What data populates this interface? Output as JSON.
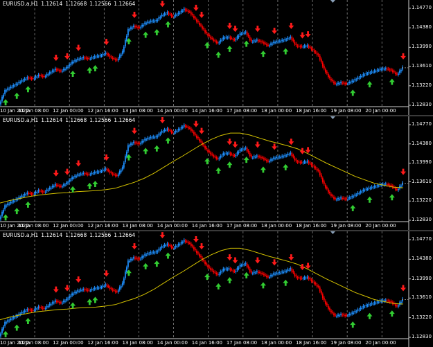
{
  "panels": [
    {
      "symbol": "EURUSD.a,H1",
      "quote": [
        "1.12614",
        "1.12668",
        "1.12566",
        "1.12664"
      ],
      "show_ma": false
    },
    {
      "symbol": "EURUSD.a,H1",
      "quote": [
        "1.12614",
        "1.12668",
        "1.12566",
        "1.12664"
      ],
      "show_ma": true
    },
    {
      "symbol": "EURUSD.a,H1",
      "quote": [
        "1.12614",
        "1.12668",
        "1.12566",
        "1.12664"
      ],
      "show_ma": true
    }
  ],
  "price_axis": [
    "1.14770",
    "1.14380",
    "1.13990",
    "1.13610",
    "1.13220",
    "1.12830"
  ],
  "time_axis": [
    "10 Jan 2022",
    "11 Jan 08:00",
    "12 Jan 00:00",
    "12 Jan 16:00",
    "13 Jan 08:00",
    "14 Jan 00:00",
    "14 Jan 16:00",
    "17 Jan 08:00",
    "18 Jan 00:00",
    "18 Jan 16:00",
    "19 Jan 08:00",
    "20 Jan 00:00"
  ],
  "colors": {
    "background": "#000000",
    "bull": "#1E90FF",
    "bear": "#FF0000",
    "arrow_up": "#32CD32",
    "arrow_down": "#FF1A1A",
    "ma": "#D4C200",
    "grid": "#8a8a8a"
  },
  "chart_data": {
    "type": "line",
    "x_label_ticks": [
      "10 Jan 2022",
      "11 Jan 08:00",
      "12 Jan 00:00",
      "12 Jan 16:00",
      "13 Jan 08:00",
      "14 Jan 00:00",
      "14 Jan 16:00",
      "17 Jan 08:00",
      "18 Jan 00:00",
      "18 Jan 16:00",
      "19 Jan 08:00",
      "20 Jan 00:00"
    ],
    "ylim": [
      1.1283,
      1.1477
    ],
    "series": [
      {
        "values": [
          1.1285,
          1.1312,
          1.1319,
          1.1325,
          1.1332,
          1.1338,
          1.1336,
          1.1343,
          1.134,
          1.1348,
          1.1355,
          1.1351,
          1.1358,
          1.1369,
          1.1375,
          1.1378,
          1.1376,
          1.138,
          1.1382,
          1.1387,
          1.1378,
          1.1373,
          1.139,
          1.1434,
          1.1441,
          1.1438,
          1.1447,
          1.1451,
          1.1452,
          1.1463,
          1.1468,
          1.146,
          1.1467,
          1.1475,
          1.1469,
          1.1455,
          1.1441,
          1.1426,
          1.1415,
          1.1407,
          1.1418,
          1.1419,
          1.1413,
          1.1426,
          1.1429,
          1.141,
          1.1413,
          1.1409,
          1.1402,
          1.1409,
          1.1411,
          1.1414,
          1.1419,
          1.1402,
          1.14,
          1.1402,
          1.1393,
          1.1382,
          1.1355,
          1.1336,
          1.1325,
          1.1328,
          1.1326,
          1.1331,
          1.1337,
          1.1344,
          1.1348,
          1.1351,
          1.1355,
          1.1356,
          1.1353,
          1.1344,
          1.1358
        ]
      }
    ],
    "ma_values": [
      1.1318,
      1.1323,
      1.1327,
      1.1331,
      1.1334,
      1.1336,
      1.1338,
      1.1339,
      1.1341,
      1.1342,
      1.1343,
      1.1345,
      1.1348,
      1.1354,
      1.136,
      1.1368,
      1.1378,
      1.139,
      1.1402,
      1.1413,
      1.1425,
      1.1437,
      1.1447,
      1.1455,
      1.146,
      1.146,
      1.1456,
      1.145,
      1.1444,
      1.1439,
      1.1434,
      1.1428,
      1.1419,
      1.1409,
      1.1399,
      1.139,
      1.1381,
      1.1372,
      1.1365,
      1.1358,
      1.1354,
      1.135,
      1.1349
    ],
    "arrows_up_idx": [
      1,
      3,
      5,
      13,
      16,
      17,
      23,
      26,
      28,
      30,
      37,
      39,
      41,
      44,
      47,
      51,
      63,
      66,
      70,
      75
    ],
    "arrows_down_idx": [
      10,
      12,
      14,
      19,
      24,
      29,
      35,
      36,
      41,
      42,
      46,
      49,
      52,
      54,
      55,
      72
    ]
  }
}
